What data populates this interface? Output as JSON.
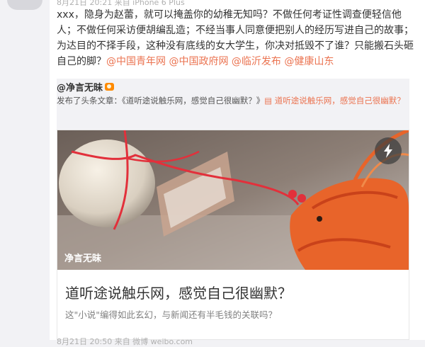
{
  "post": {
    "meta_top": "8月21日 20:21 来自 iPhone 6 Plus",
    "text_prefix": "xxx，隐身为赵蕾，就可以掩盖你的幼稚无知吗？不做任何考证性调查便轻信他人；不做任何采访便胡编乱造；不经当事人同意便把别人的经历写进自己的故事；为达目的不择手段，这种没有底线的女大学生，你决对抵毁不了谁？只能搬石头砸自己的脚？",
    "mentions": [
      "@中国青年网",
      "@中国政府网",
      "@临沂发布",
      "@健康山东"
    ]
  },
  "repost": {
    "author": "@净言无昧",
    "prefix": "发布了头条文章：《道听途说触乐网，感觉自己很幽默？》",
    "link_text": "道听途说触乐网，感觉自己很幽默？",
    "card": {
      "overlay_text": "净言无昧",
      "title": "道听途说触乐网，感觉自己很幽默？",
      "description": "这\"小说\"编得如此玄幻，与新闻还有半毛钱的关联吗？",
      "play_icon": "lightning-icon"
    }
  },
  "bottom_meta": "8月21日 20:50 来自 微博 weibo.com"
}
